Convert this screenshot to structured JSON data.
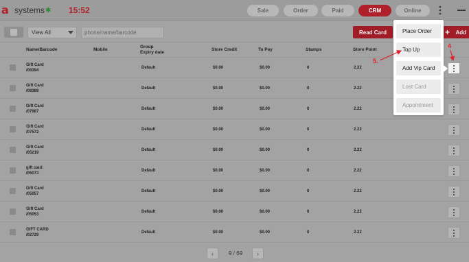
{
  "app": {
    "logo_mark": "a",
    "logo_text": "systems",
    "clock": "15:52"
  },
  "nav": {
    "sale": "Sale",
    "order": "Order",
    "paid": "Paid",
    "crm": "CRM",
    "online": "Online"
  },
  "toolbar": {
    "view_selected": "View All",
    "search_placeholder": "phone/name/barcode",
    "read_card": "Read Card",
    "add": "Add"
  },
  "table": {
    "headers": {
      "name": "Name/Barcode",
      "mobile": "Mobile",
      "group": "Group",
      "expiry": "Expiry date",
      "credit": "Store Credit",
      "topay": "To Pay",
      "stamps": "Stamps",
      "point": "Store Point"
    },
    "rows": [
      {
        "name": "Gift Card",
        "barcode": "/08394",
        "group": "Default",
        "credit": "$0.00",
        "topay": "$0.00",
        "stamps": "0",
        "point": "2.22"
      },
      {
        "name": "Gift Card",
        "barcode": "/08388",
        "group": "Default",
        "credit": "$0.00",
        "topay": "$0.00",
        "stamps": "0",
        "point": "2.22"
      },
      {
        "name": "Gift Card",
        "barcode": "/07987",
        "group": "Default",
        "credit": "$0.00",
        "topay": "$0.00",
        "stamps": "0",
        "point": "2.22"
      },
      {
        "name": "Gift Card",
        "barcode": "/07572",
        "group": "Default",
        "credit": "$0.00",
        "topay": "$0.00",
        "stamps": "0",
        "point": "2.22"
      },
      {
        "name": "Gift Card",
        "barcode": "/05219",
        "group": "Default",
        "credit": "$0.00",
        "topay": "$0.00",
        "stamps": "0",
        "point": "2.22"
      },
      {
        "name": "gift card",
        "barcode": "/05073",
        "group": "Default",
        "credit": "$0.00",
        "topay": "$0.00",
        "stamps": "0",
        "point": "2.22"
      },
      {
        "name": "Gift Card",
        "barcode": "/05057",
        "group": "Default",
        "credit": "$0.00",
        "topay": "$0.00",
        "stamps": "0",
        "point": "2.22"
      },
      {
        "name": "Gift Card",
        "barcode": "/05053",
        "group": "Default",
        "credit": "$0.00",
        "topay": "$0.00",
        "stamps": "0",
        "point": "2.22"
      },
      {
        "name": "GIFT CARD",
        "barcode": "/02729",
        "group": "Default",
        "credit": "$0.00",
        "topay": "$0.00",
        "stamps": "0",
        "point": "2.22"
      }
    ]
  },
  "pagination": {
    "text": "9 / 69",
    "prev_icon": "chevron-left-icon",
    "next_icon": "chevron-right-icon"
  },
  "popup": {
    "items": [
      {
        "label": "Place Order",
        "enabled": true
      },
      {
        "label": "Top Up",
        "enabled": true
      },
      {
        "label": "Add Vip Card",
        "enabled": true
      },
      {
        "label": "Lost Card",
        "enabled": false
      },
      {
        "label": "Appointment",
        "enabled": false
      }
    ]
  },
  "annotations": {
    "step4": "4",
    "step5": "5.",
    "color": "#e0202a"
  },
  "colors": {
    "brand_red": "#b0202b",
    "overlay_gray": "#a3a3a3"
  }
}
